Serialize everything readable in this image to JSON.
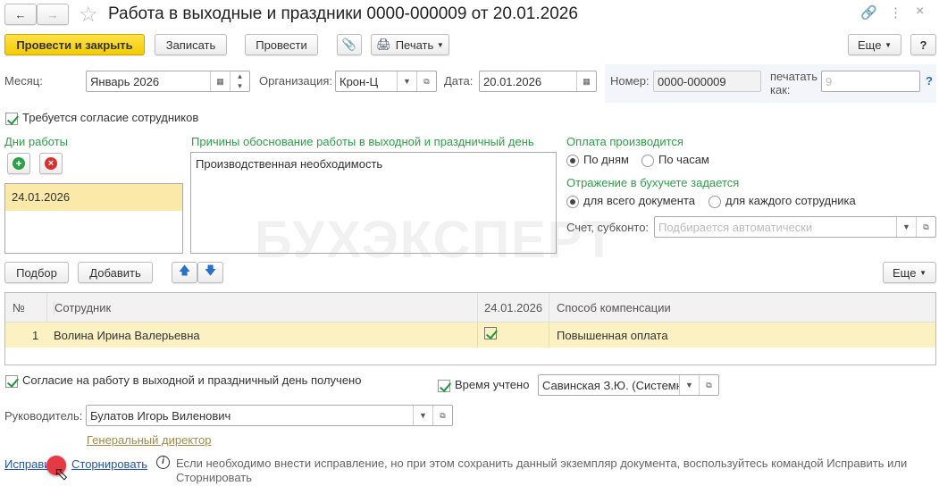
{
  "title": "Работа в выходные и праздники 0000-000009 от 20.01.2026",
  "toolbar": {
    "post_close": "Провести и закрыть",
    "save": "Записать",
    "post": "Провести",
    "print": "Печать",
    "more": "Еще",
    "help": "?"
  },
  "header": {
    "month_label": "Месяц:",
    "month": "Январь 2026",
    "org_label": "Организация:",
    "org": "Крон-Ц",
    "date_label": "Дата:",
    "date": "20.01.2026",
    "number_label": "Номер:",
    "number": "0000-000009",
    "print_as_label": "печатать как:",
    "print_as_placeholder": "9",
    "help": "?"
  },
  "consent_required": "Требуется согласие сотрудников",
  "days": {
    "title": "Дни работы",
    "items": [
      "24.01.2026"
    ]
  },
  "reasons": {
    "title": "Причины обоснование работы в выходной и праздничный день",
    "value": "Производственная необходимость"
  },
  "payment": {
    "title": "Оплата производится",
    "opt1": "По дням",
    "opt2": "По часам",
    "reflect_title": "Отражение в бухучете задается",
    "ref1": "для всего документа",
    "ref2": "для каждого сотрудника",
    "account_label": "Счет, субконто:",
    "account_placeholder": "Подбирается автоматически"
  },
  "table_toolbar": {
    "pick": "Подбор",
    "add": "Добавить",
    "more": "Еще"
  },
  "table": {
    "headers": [
      "№",
      "Сотрудник",
      "24.01.2026",
      "Способ компенсации"
    ],
    "rows": [
      {
        "n": "1",
        "employee": "Волина Ирина Валерьевна",
        "comp": "Повышенная оплата"
      }
    ]
  },
  "consent_received": "Согласие на работу в выходной и праздничный день получено",
  "time_counted": "Время учтено",
  "time_user": "Савинская З.Ю. (Системн",
  "manager_label": "Руководитель:",
  "manager": "Булатов Игорь Виленович",
  "manager_position": "Генеральный директор",
  "links": {
    "fix": "Исправить",
    "storno": "Сторнировать"
  },
  "info": "Если необходимо внести исправление, но при этом сохранить данный экземпляр документа, воспользуйтесь командой Исправить или Сторнировать",
  "watermark": "БУХЭКСПЕРТ"
}
